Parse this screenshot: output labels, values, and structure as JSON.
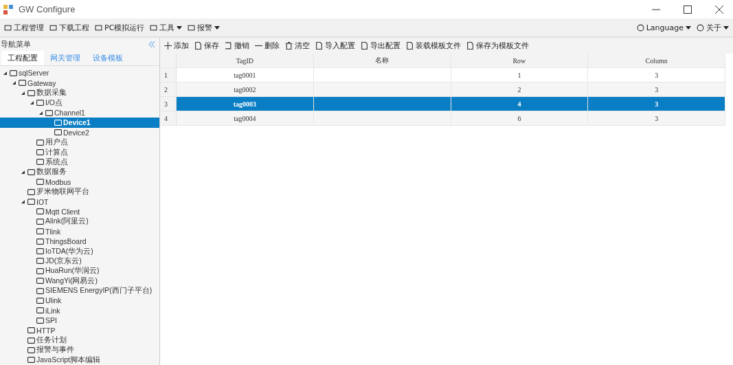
{
  "window": {
    "title": "GW Configure"
  },
  "menubar": {
    "left": [
      {
        "label": "工程管理",
        "dropdown": false
      },
      {
        "label": "下载工程",
        "dropdown": false
      },
      {
        "label": "PC模拟运行",
        "dropdown": false
      },
      {
        "label": "工具",
        "dropdown": true
      },
      {
        "label": "报警",
        "dropdown": true
      }
    ],
    "right": [
      {
        "label": "Language",
        "dropdown": true
      },
      {
        "label": "关于",
        "dropdown": true
      }
    ]
  },
  "sidebar": {
    "title": "导航菜单",
    "tabs": [
      {
        "label": "工程配置",
        "selected": true
      },
      {
        "label": "网关管理",
        "selected": false
      },
      {
        "label": "设备模板",
        "selected": false
      }
    ],
    "tree": [
      {
        "label": "sqlServer",
        "expanded": true,
        "selected": false,
        "children": [
          {
            "label": "Gateway",
            "expanded": true,
            "selected": false,
            "children": [
              {
                "label": "数据采集",
                "expanded": true,
                "selected": false,
                "children": [
                  {
                    "label": "I/O点",
                    "expanded": true,
                    "selected": false,
                    "children": [
                      {
                        "label": "Channel1",
                        "expanded": true,
                        "selected": false,
                        "children": [
                          {
                            "label": "Device1",
                            "selected": true
                          },
                          {
                            "label": "Device2",
                            "selected": false
                          }
                        ]
                      }
                    ]
                  },
                  {
                    "label": "用户点",
                    "selected": false
                  },
                  {
                    "label": "计算点",
                    "selected": false
                  },
                  {
                    "label": "系统点",
                    "selected": false
                  }
                ]
              },
              {
                "label": "数据服务",
                "expanded": true,
                "selected": false,
                "children": [
                  {
                    "label": "Modbus",
                    "selected": false
                  }
                ]
              },
              {
                "label": "罗米物联网平台",
                "selected": false
              },
              {
                "label": "IOT",
                "expanded": true,
                "selected": false,
                "children": [
                  {
                    "label": "Mqtt Client",
                    "selected": false
                  },
                  {
                    "label": "Alink(阿里云)",
                    "selected": false
                  },
                  {
                    "label": "Tlink",
                    "selected": false
                  },
                  {
                    "label": "ThingsBoard",
                    "selected": false
                  },
                  {
                    "label": "IoTDA(华为云)",
                    "selected": false
                  },
                  {
                    "label": "JD(京东云)",
                    "selected": false
                  },
                  {
                    "label": "HuaRun(华润云)",
                    "selected": false
                  },
                  {
                    "label": "WangYi(网易云)",
                    "selected": false
                  },
                  {
                    "label": "SIEMENS EnergyIP(西门子平台)",
                    "selected": false
                  },
                  {
                    "label": "Ulink",
                    "selected": false
                  },
                  {
                    "label": "iLink",
                    "selected": false
                  },
                  {
                    "label": "SPI",
                    "selected": false
                  }
                ]
              },
              {
                "label": "HTTP",
                "selected": false
              },
              {
                "label": "任务计划",
                "selected": false
              },
              {
                "label": "报警与事件",
                "selected": false
              },
              {
                "label": "JavaScript脚本编辑",
                "selected": false
              }
            ]
          }
        ]
      }
    ]
  },
  "toolbar": [
    "添加",
    "保存",
    "撤销",
    "删除",
    "清空",
    "导入配置",
    "导出配置",
    "装载模板文件",
    "保存为模板文件"
  ],
  "table": {
    "columns": [
      "TagID",
      "名称",
      "Row",
      "Column"
    ],
    "rows": [
      {
        "number": "1",
        "cells": [
          "tag0001",
          "",
          "1",
          "3"
        ],
        "selected": false
      },
      {
        "number": "2",
        "cells": [
          "tag0002",
          "",
          "2",
          "3"
        ],
        "selected": false
      },
      {
        "number": "3",
        "cells": [
          "tag0003",
          "",
          "4",
          "3"
        ],
        "selected": true
      },
      {
        "number": "4",
        "cells": [
          "tag0004",
          "",
          "6",
          "3"
        ],
        "selected": false
      }
    ]
  }
}
